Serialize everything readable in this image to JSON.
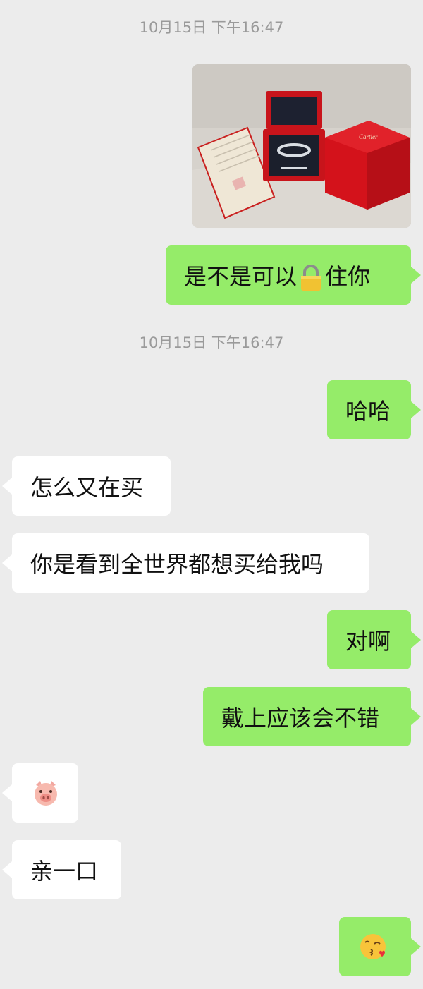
{
  "timestamps": [
    "10月15日 下午16:47",
    "10月15日 下午16:47"
  ],
  "messages": [
    {
      "side": "out",
      "type": "image",
      "description_icon": "photo-icon"
    },
    {
      "side": "out",
      "type": "text",
      "before": "是不是可以",
      "emoji": "lock-icon",
      "after": "住你"
    },
    {
      "side": "out",
      "type": "text",
      "text": "哈哈"
    },
    {
      "side": "in",
      "type": "text",
      "text": "怎么又在买"
    },
    {
      "side": "in",
      "type": "text",
      "text": "你是看到全世界都想买给我吗"
    },
    {
      "side": "out",
      "type": "text",
      "text": "对啊"
    },
    {
      "side": "out",
      "type": "text",
      "text": "戴上应该会不错"
    },
    {
      "side": "in",
      "type": "emoji",
      "emoji": "pig-face-icon"
    },
    {
      "side": "in",
      "type": "text",
      "text": "亲一口"
    },
    {
      "side": "out",
      "type": "emoji",
      "emoji": "kissing-face-icon"
    }
  ],
  "photo_labels": {
    "brand": "Cartier"
  },
  "colors": {
    "background": "#ececec",
    "out_bubble": "#95ec69",
    "in_bubble": "#ffffff",
    "timestamp": "#9a9a9a"
  }
}
